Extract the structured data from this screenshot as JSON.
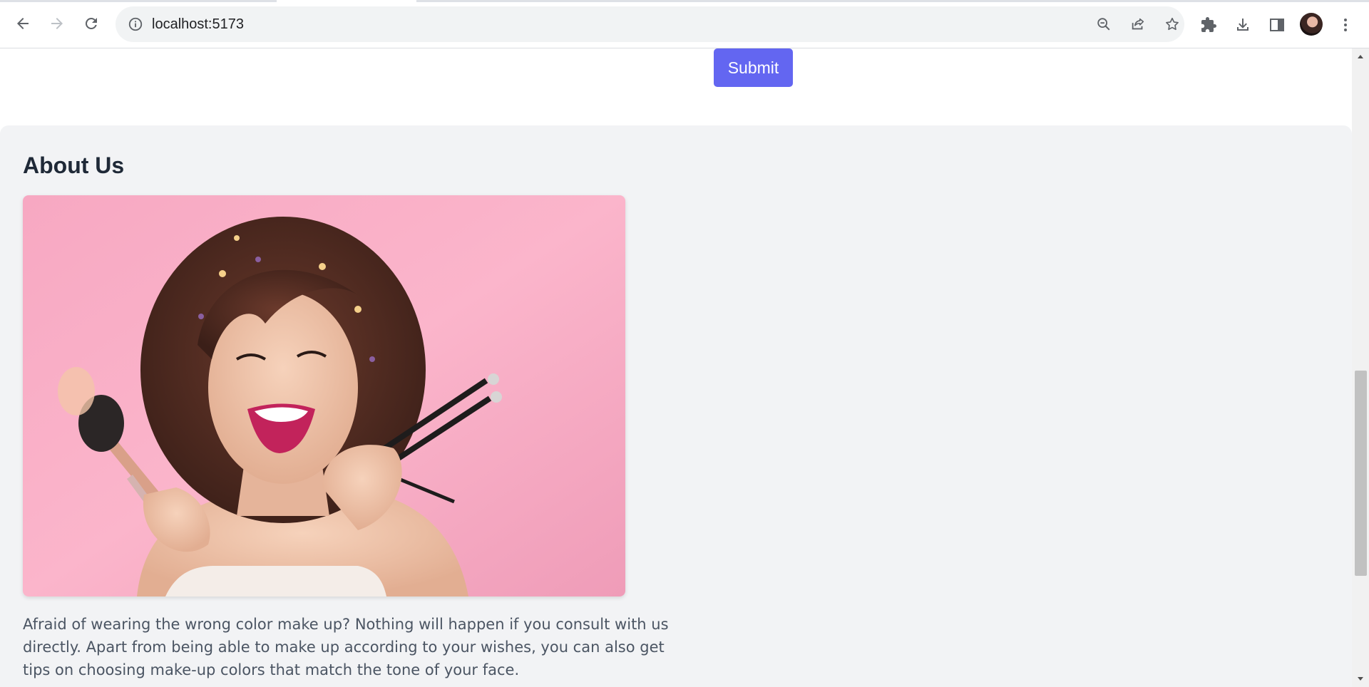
{
  "browser": {
    "url": "localhost:5173",
    "icons": {
      "back": "arrow-left-icon",
      "forward": "arrow-right-icon",
      "reload": "reload-icon",
      "site_info": "info-icon",
      "zoom": "zoom-out-icon",
      "share": "share-icon",
      "bookmark": "star-icon",
      "extensions": "puzzle-icon",
      "downloads": "download-icon",
      "side_panel": "side-panel-icon",
      "menu": "kebab-menu-icon"
    }
  },
  "form": {
    "submit_label": "Submit",
    "accent_color": "#6366f1"
  },
  "about": {
    "heading": "About Us",
    "image_alt": "Smiling woman holding makeup brushes against a pink background",
    "paragraph": "Afraid of wearing the wrong color make up? Nothing will happen if you consult with us directly. Apart from being able to make up according to your wishes, you can also get tips on choosing make-up colors that match the tone of your face.",
    "background_color": "#f2f3f5"
  }
}
